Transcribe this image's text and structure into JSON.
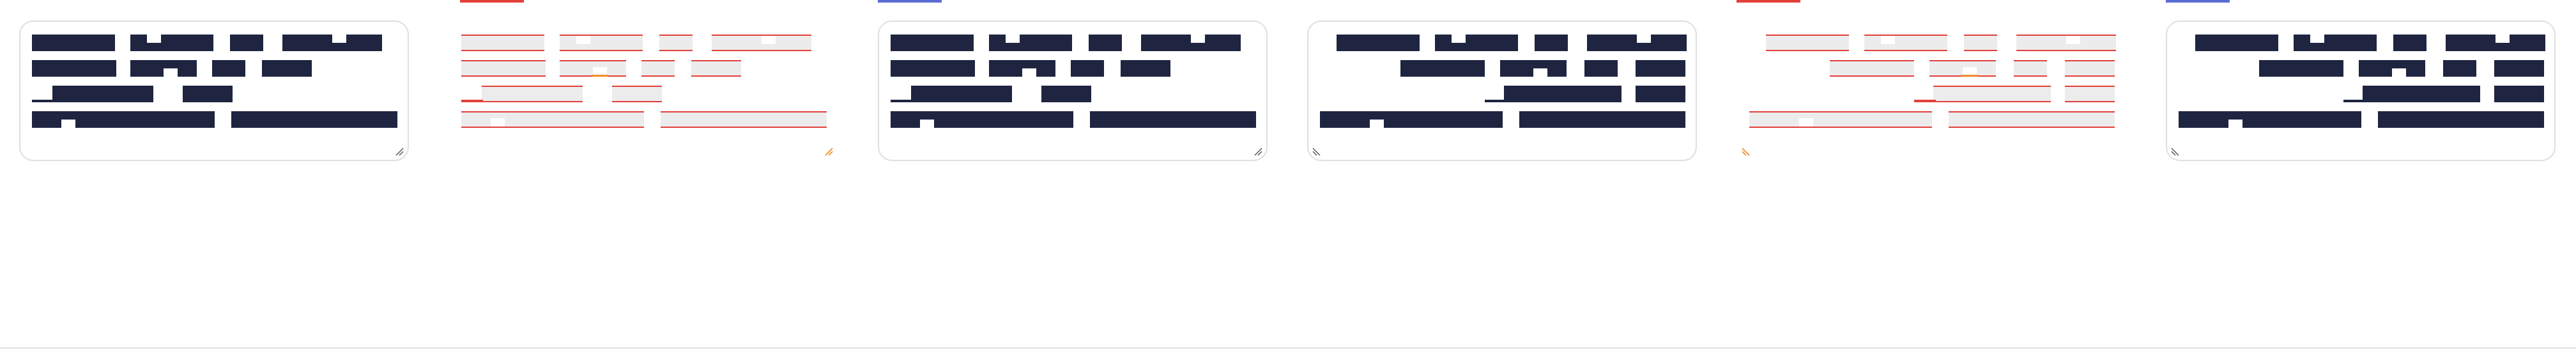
{
  "screen": {
    "description_text": "",
    "panels": [
      {
        "id": 1,
        "variant": "normal",
        "card_outlined": true,
        "grip": "right",
        "accent_color": ""
      },
      {
        "id": 2,
        "variant": "diff",
        "card_outlined": false,
        "grip": "right-orange",
        "accent_color": "#e2403a"
      },
      {
        "id": 3,
        "variant": "normal",
        "card_outlined": true,
        "grip": "right",
        "accent_color": "#5b6bd5"
      },
      {
        "id": 4,
        "variant": "normal",
        "card_outlined": true,
        "grip": "left",
        "accent_color": ""
      },
      {
        "id": 5,
        "variant": "diff",
        "card_outlined": false,
        "grip": "left-orange",
        "accent_color": "#e2403a"
      },
      {
        "id": 6,
        "variant": "normal",
        "card_outlined": true,
        "grip": "left",
        "accent_color": "#5b6bd5"
      }
    ]
  },
  "colors": {
    "text_block": "#1f2540",
    "card_border": "#dddfe3",
    "diff_red": "#e2403a",
    "diff_fill": "#ececec",
    "grip_orange": "#f28c28",
    "accent_blue": "#5b6bd5"
  },
  "icons": {
    "resize_grip": "resize-grip-icon"
  }
}
